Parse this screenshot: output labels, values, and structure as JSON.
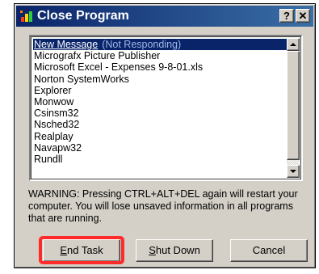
{
  "window": {
    "title": "Close Program",
    "help_label": "?",
    "close_label": "✕"
  },
  "task_list": {
    "selected": {
      "name": "New Message",
      "status": "(Not Responding)"
    },
    "items": [
      "Micrografx Picture Publisher",
      "Microsoft Excel - Expenses 9-8-01.xls",
      "Norton SystemWorks",
      "Explorer",
      "Monwow",
      "Csinsm32",
      "Nsched32",
      "Realplay",
      "Navapw32",
      "Rundll"
    ]
  },
  "warning": "WARNING: Pressing CTRL+ALT+DEL again will restart your computer. You will lose unsaved information in all programs that are running.",
  "buttons": {
    "end_task": {
      "mnemonic": "E",
      "rest": "nd Task"
    },
    "shut_down": {
      "mnemonic": "S",
      "rest": "hut Down"
    },
    "cancel": {
      "label": "Cancel"
    }
  },
  "colors": {
    "titlebar_start": "#0a246a",
    "titlebar_end": "#3a6ea5",
    "face": "#d4d0c8",
    "selection": "#0a246a",
    "highlight": "#ff2a2a"
  },
  "icons": {
    "app": "close-program-icon",
    "help": "question-mark-icon",
    "close": "close-icon",
    "scroll_up": "scroll-up-arrow-icon",
    "scroll_down": "scroll-down-arrow-icon"
  }
}
